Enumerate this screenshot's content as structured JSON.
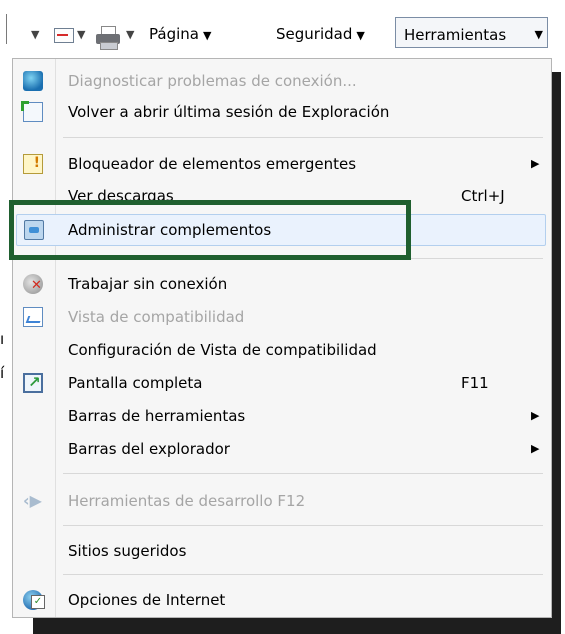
{
  "toolbar": {
    "page_label": "Página",
    "security_label": "Seguridad",
    "tools_label": "Herramientas"
  },
  "menu": {
    "items": [
      {
        "label": "Diagnosticar problemas de conexión...",
        "icon": "network-diagnostics-icon",
        "disabled": true
      },
      {
        "label": "Volver a abrir última sesión de Exploración",
        "icon": "reopen-session-icon"
      },
      {
        "label": "Bloqueador de elementos emergentes",
        "icon": "popup-blocker-icon",
        "submenu": true
      },
      {
        "label": "Ver descargas",
        "shortcut": "Ctrl+J"
      },
      {
        "label": "Administrar complementos",
        "icon": "manage-addons-icon",
        "highlighted": true
      },
      {
        "label": "Trabajar sin conexión",
        "icon": "work-offline-icon"
      },
      {
        "label": "Vista de compatibilidad",
        "icon": "compatibility-view-icon",
        "disabled": true
      },
      {
        "label": "Configuración de Vista de compatibilidad"
      },
      {
        "label": "Pantalla completa",
        "icon": "full-screen-icon",
        "shortcut": "F11"
      },
      {
        "label": "Barras de herramientas",
        "submenu": true
      },
      {
        "label": "Barras del explorador",
        "submenu": true
      },
      {
        "label": "Herramientas de desarrollo F12",
        "icon": "developer-tools-icon",
        "disabled": true
      },
      {
        "label": "Sitios sugeridos"
      },
      {
        "label": "Opciones de Internet",
        "icon": "internet-options-icon"
      }
    ]
  },
  "colors": {
    "focus_box": "#1f5f2f",
    "highlight_bg": "#eaf2fd",
    "disabled_text": "#a5a5a5"
  }
}
